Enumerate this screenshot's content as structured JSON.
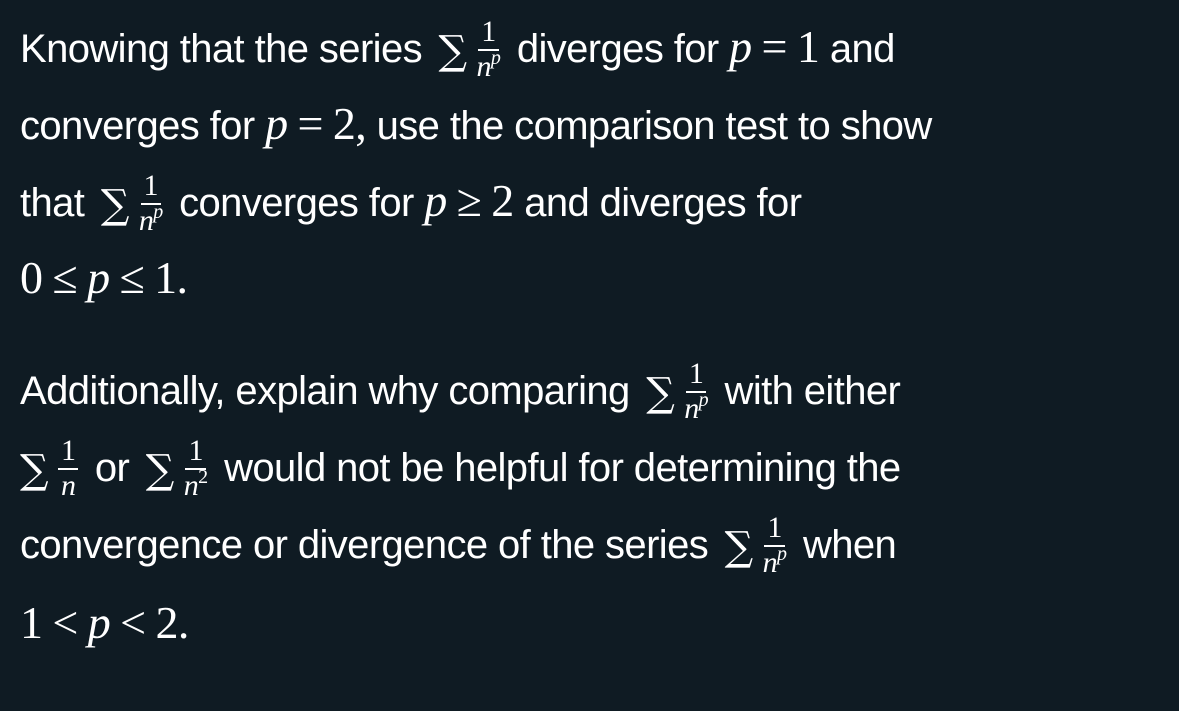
{
  "document": {
    "paragraph_1": {
      "t1": "Knowing that the series",
      "sum": "∑",
      "frac1": {
        "num": "1",
        "den": "n",
        "exp": "p"
      },
      "t2": "diverges for",
      "cond1": {
        "var": "p",
        "op": "=",
        "val": "1"
      },
      "t3": "and",
      "t4": "converges for",
      "cond2": {
        "var": "p",
        "op": "=",
        "val": "2,"
      },
      "t5": "use the comparison test to show",
      "t6": "that",
      "frac2": {
        "num": "1",
        "den": "n",
        "exp": "p"
      },
      "t7": "converges for",
      "cond3": {
        "var": "p",
        "op": "≥",
        "val": "2"
      },
      "t8": "and diverges for",
      "cond4": {
        "lo": "0",
        "op1": "≤",
        "var": "p",
        "op2": "≤",
        "hi": "1."
      }
    },
    "paragraph_2": {
      "t1": "Additionally, explain why comparing",
      "sum": "∑",
      "frac1": {
        "num": "1",
        "den": "n",
        "exp": "p"
      },
      "t2": "with either",
      "frac2": {
        "num": "1",
        "den": "n"
      },
      "t3": "or",
      "frac3": {
        "num": "1",
        "den": "n",
        "exp": "2"
      },
      "t4": "would not be helpful for determining the",
      "t5": "convergence or divergence of the series",
      "frac4": {
        "num": "1",
        "den": "n",
        "exp": "p"
      },
      "t6": "when",
      "cond": {
        "lo": "1",
        "op1": "<",
        "var": "p",
        "op2": "<",
        "hi": "2."
      }
    }
  },
  "colors": {
    "background": "#0f1b23",
    "text": "#ffffff"
  }
}
